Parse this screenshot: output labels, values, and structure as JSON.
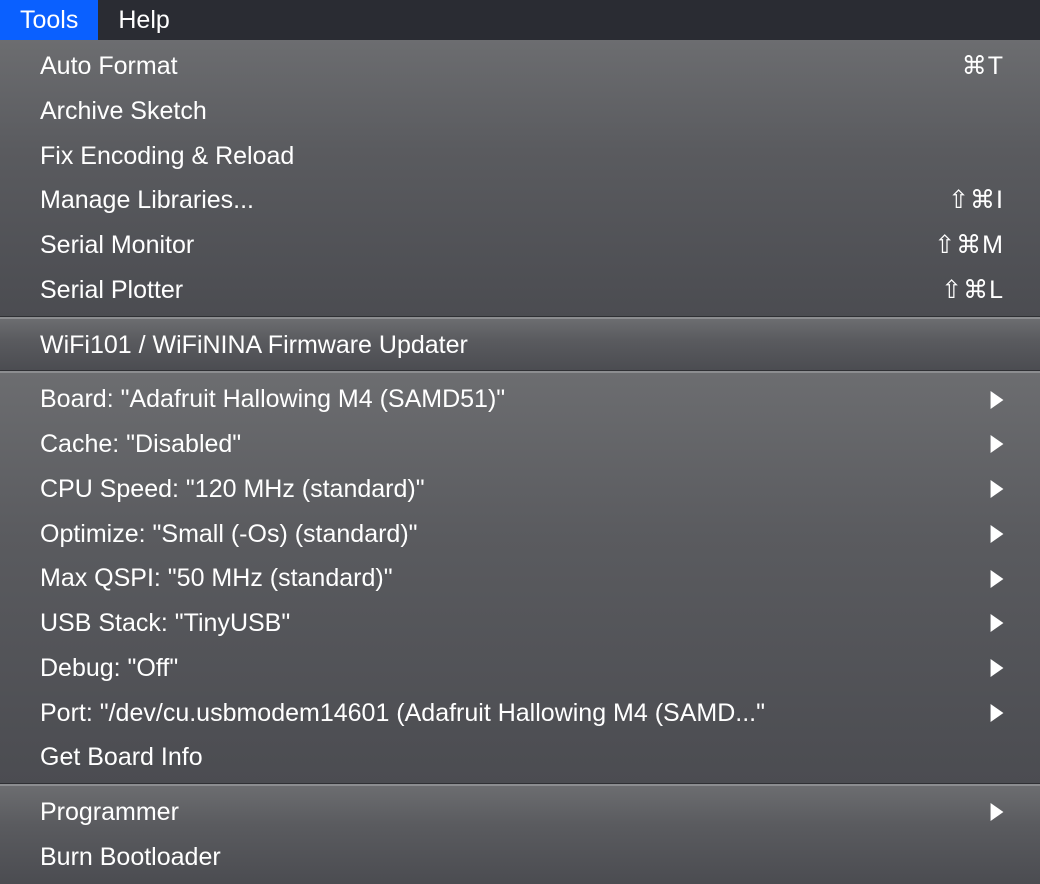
{
  "menubar": {
    "items": [
      {
        "label": "Tools",
        "active": true
      },
      {
        "label": "Help",
        "active": false
      }
    ]
  },
  "menu": {
    "sections": [
      {
        "items": [
          {
            "label": "Auto Format",
            "shortcut": "⌘T"
          },
          {
            "label": "Archive Sketch"
          },
          {
            "label": "Fix Encoding & Reload"
          },
          {
            "label": "Manage Libraries...",
            "shortcut": "⇧⌘I"
          },
          {
            "label": "Serial Monitor",
            "shortcut": "⇧⌘M"
          },
          {
            "label": "Serial Plotter",
            "shortcut": "⇧⌘L"
          }
        ]
      },
      {
        "items": [
          {
            "label": "WiFi101 / WiFiNINA Firmware Updater"
          }
        ]
      },
      {
        "items": [
          {
            "label": "Board: \"Adafruit Hallowing M4 (SAMD51)\"",
            "submenu": true
          },
          {
            "label": "Cache: \"Disabled\"",
            "submenu": true
          },
          {
            "label": "CPU Speed: \"120 MHz (standard)\"",
            "submenu": true
          },
          {
            "label": "Optimize: \"Small (-Os) (standard)\"",
            "submenu": true
          },
          {
            "label": "Max QSPI: \"50 MHz (standard)\"",
            "submenu": true
          },
          {
            "label": "USB Stack: \"TinyUSB\"",
            "submenu": true
          },
          {
            "label": "Debug: \"Off\"",
            "submenu": true
          },
          {
            "label": "Port: \"/dev/cu.usbmodem14601 (Adafruit Hallowing M4 (SAMD...\"",
            "submenu": true
          },
          {
            "label": "Get Board Info"
          }
        ]
      },
      {
        "items": [
          {
            "label": "Programmer",
            "submenu": true
          },
          {
            "label": "Burn Bootloader"
          }
        ]
      }
    ]
  }
}
